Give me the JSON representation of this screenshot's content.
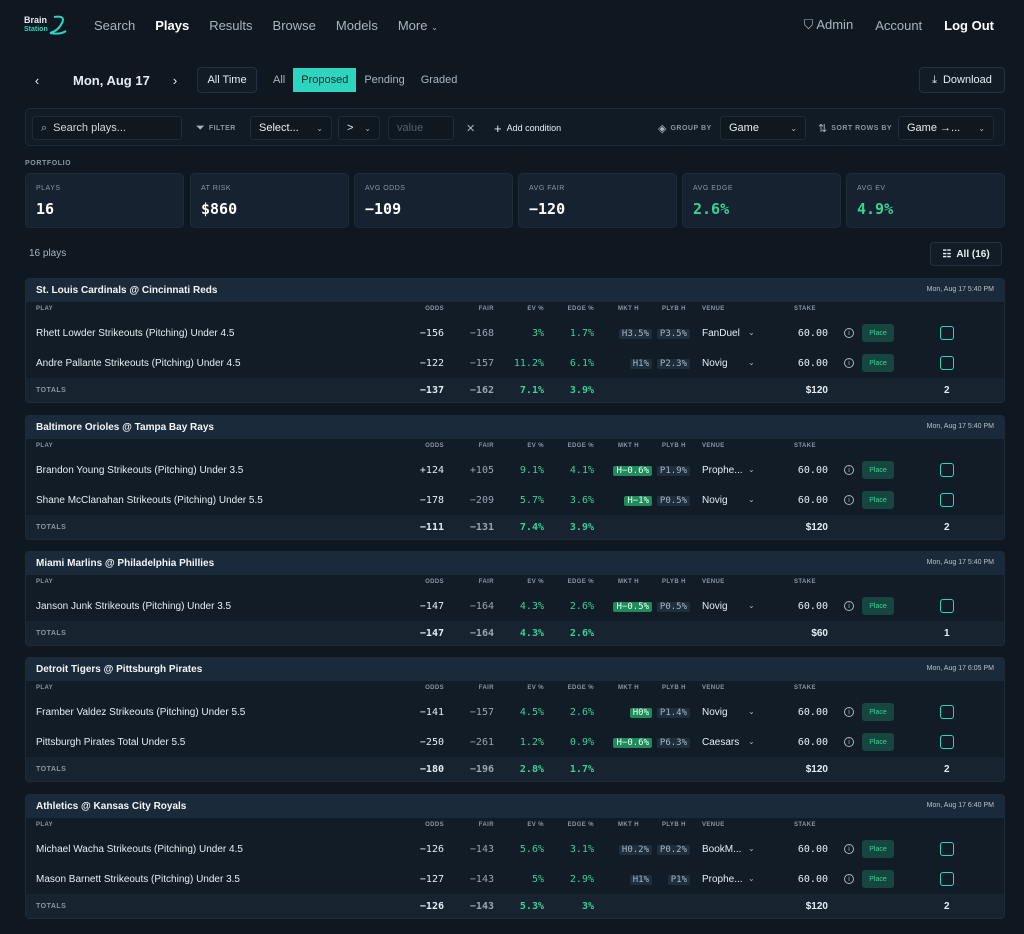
{
  "nav": {
    "logo_line1": "Brain",
    "logo_line2": "Station",
    "links": [
      "Search",
      "Plays",
      "Results",
      "Browse",
      "Models",
      "More"
    ],
    "active": "Plays",
    "admin": "Admin",
    "account": "Account",
    "logout": "Log Out"
  },
  "toolbar": {
    "date": "Mon, Aug 17",
    "all_time": "All Time",
    "segments": [
      "All",
      "Proposed",
      "Pending",
      "Graded"
    ],
    "active_segment": "Proposed",
    "download": "Download"
  },
  "filters": {
    "search_placeholder": "Search plays...",
    "filter_label": "FILTER",
    "select_value": "Select...",
    "operator": ">",
    "value_placeholder": "value",
    "add_condition": "Add condition",
    "group_by_label": "GROUP BY",
    "group_by_value": "Game",
    "sort_label": "SORT ROWS BY",
    "sort_value": "Game →..."
  },
  "portfolio": {
    "label": "PORTFOLIO",
    "stats": [
      {
        "key": "PLAYS",
        "value": "16",
        "green": false
      },
      {
        "key": "AT RISK",
        "value": "$860",
        "green": false
      },
      {
        "key": "AVG ODDS",
        "value": "−109",
        "green": false
      },
      {
        "key": "AVG FAIR",
        "value": "−120",
        "green": false
      },
      {
        "key": "AVG EDGE",
        "value": "2.6%",
        "green": true
      },
      {
        "key": "AVG EV",
        "value": "4.9%",
        "green": true
      }
    ]
  },
  "list": {
    "count": "16 plays",
    "all_button": "All (16)"
  },
  "columns": {
    "play": "PLAY",
    "odds": "ODDS",
    "fair": "FAIR",
    "ev": "EV %",
    "edge": "EDGE %",
    "mkt": "MKT H",
    "plyb": "PLYB H",
    "venue": "VENUE",
    "stake": "STAKE",
    "totals": "TOTALS",
    "place": "Place"
  },
  "groups": [
    {
      "title": "St. Louis Cardinals @ Cincinnati Reds",
      "time": "Mon, Aug 17 5:40 PM",
      "rows": [
        {
          "play": "Rhett Lowder Strikeouts (Pitching) Under 4.5",
          "odds": "−156",
          "fair": "−168",
          "ev": "3%",
          "edge": "1.7%",
          "mkt": "H3.5%",
          "mkt_pos": false,
          "plyb": "P3.5%",
          "venue": "FanDuel",
          "stake": "60.00"
        },
        {
          "play": "Andre Pallante Strikeouts (Pitching) Under 4.5",
          "odds": "−122",
          "fair": "−157",
          "ev": "11.2%",
          "edge": "6.1%",
          "mkt": "H1%",
          "mkt_pos": false,
          "plyb": "P2.3%",
          "venue": "Novig",
          "stake": "60.00"
        }
      ],
      "totals": {
        "odds": "−137",
        "fair": "−162",
        "ev": "7.1%",
        "edge": "3.9%",
        "stake": "$120",
        "count": "2"
      }
    },
    {
      "title": "Baltimore Orioles @ Tampa Bay Rays",
      "time": "Mon, Aug 17 5:40 PM",
      "rows": [
        {
          "play": "Brandon Young Strikeouts (Pitching) Under 3.5",
          "odds": "+124",
          "fair": "+105",
          "ev": "9.1%",
          "edge": "4.1%",
          "mkt": "H−0.6%",
          "mkt_pos": true,
          "plyb": "P1.9%",
          "venue": "Prophe...",
          "stake": "60.00"
        },
        {
          "play": "Shane McClanahan Strikeouts (Pitching) Under 5.5",
          "odds": "−178",
          "fair": "−209",
          "ev": "5.7%",
          "edge": "3.6%",
          "mkt": "H−1%",
          "mkt_pos": true,
          "plyb": "P0.5%",
          "venue": "Novig",
          "stake": "60.00"
        }
      ],
      "totals": {
        "odds": "−111",
        "fair": "−131",
        "ev": "7.4%",
        "edge": "3.9%",
        "stake": "$120",
        "count": "2"
      }
    },
    {
      "title": "Miami Marlins @ Philadelphia Phillies",
      "time": "Mon, Aug 17 5:40 PM",
      "rows": [
        {
          "play": "Janson Junk Strikeouts (Pitching) Under 3.5",
          "odds": "−147",
          "fair": "−164",
          "ev": "4.3%",
          "edge": "2.6%",
          "mkt": "H−0.5%",
          "mkt_pos": true,
          "plyb": "P0.5%",
          "venue": "Novig",
          "stake": "60.00"
        }
      ],
      "totals": {
        "odds": "−147",
        "fair": "−164",
        "ev": "4.3%",
        "edge": "2.6%",
        "stake": "$60",
        "count": "1"
      }
    },
    {
      "title": "Detroit Tigers @ Pittsburgh Pirates",
      "time": "Mon, Aug 17 6:05 PM",
      "rows": [
        {
          "play": "Framber Valdez Strikeouts (Pitching) Under 5.5",
          "odds": "−141",
          "fair": "−157",
          "ev": "4.5%",
          "edge": "2.6%",
          "mkt": "H0%",
          "mkt_pos": true,
          "plyb": "P1.4%",
          "venue": "Novig",
          "stake": "60.00"
        },
        {
          "play": "Pittsburgh Pirates Total Under 5.5",
          "odds": "−250",
          "fair": "−261",
          "ev": "1.2%",
          "edge": "0.9%",
          "mkt": "H−0.6%",
          "mkt_pos": true,
          "plyb": "P6.3%",
          "venue": "Caesars",
          "stake": "60.00"
        }
      ],
      "totals": {
        "odds": "−180",
        "fair": "−196",
        "ev": "2.8%",
        "edge": "1.7%",
        "stake": "$120",
        "count": "2"
      }
    },
    {
      "title": "Athletics @ Kansas City Royals",
      "time": "Mon, Aug 17 6:40 PM",
      "rows": [
        {
          "play": "Michael Wacha Strikeouts (Pitching) Under 4.5",
          "odds": "−126",
          "fair": "−143",
          "ev": "5.6%",
          "edge": "3.1%",
          "mkt": "H0.2%",
          "mkt_pos": false,
          "plyb": "P0.2%",
          "venue": "BookM...",
          "stake": "60.00"
        },
        {
          "play": "Mason Barnett Strikeouts (Pitching) Under 3.5",
          "odds": "−127",
          "fair": "−143",
          "ev": "5%",
          "edge": "2.9%",
          "mkt": "H1%",
          "mkt_pos": false,
          "plyb": "P1%",
          "venue": "Prophe...",
          "stake": "60.00"
        }
      ],
      "totals": {
        "odds": "−126",
        "fair": "−143",
        "ev": "5.3%",
        "edge": "3%",
        "stake": "$120",
        "count": "2"
      }
    }
  ]
}
